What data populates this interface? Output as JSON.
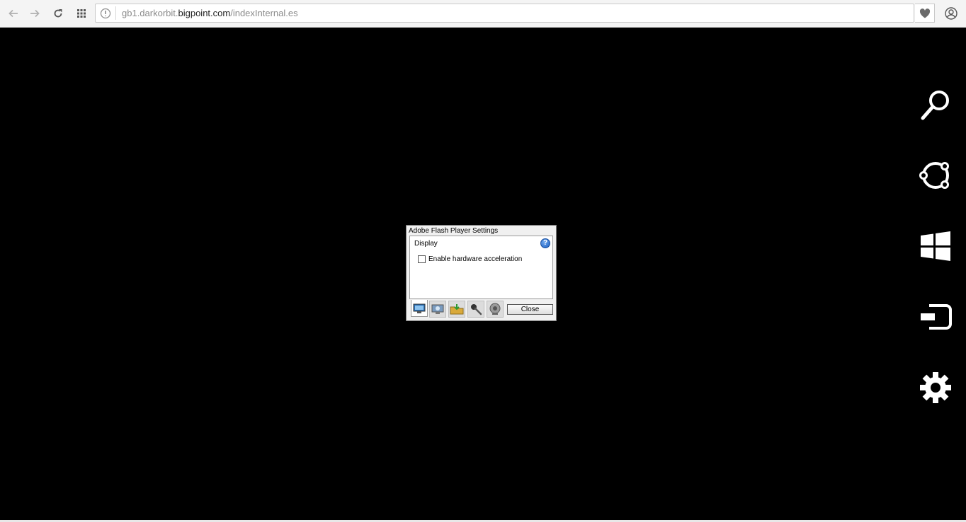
{
  "browser": {
    "url_prefix": "gb1.darkorbit.",
    "url_domain": "bigpoint.com",
    "url_path": "/indexInternal.es",
    "icons": {
      "back": "arrow-left-icon",
      "forward": "arrow-right-icon",
      "reload": "reload-icon",
      "apps": "apps-grid-icon",
      "site_info": "site-info-icon",
      "favorite": "heart-icon",
      "profile": "profile-icon"
    }
  },
  "charms": [
    {
      "name": "search",
      "icon": "search-icon"
    },
    {
      "name": "share",
      "icon": "share-icon"
    },
    {
      "name": "start",
      "icon": "windows-start-icon"
    },
    {
      "name": "devices",
      "icon": "devices-icon"
    },
    {
      "name": "settings",
      "icon": "gear-icon"
    }
  ],
  "flash_dialog": {
    "title": "Adobe Flash Player Settings",
    "section": "Display",
    "checkbox_label": "Enable hardware acceleration",
    "checkbox_checked": false,
    "close_label": "Close",
    "tabs": [
      {
        "name": "display",
        "icon": "monitor-icon",
        "active": true
      },
      {
        "name": "privacy",
        "icon": "privacy-monitor-icon",
        "active": false
      },
      {
        "name": "storage",
        "icon": "folder-download-icon",
        "active": false
      },
      {
        "name": "microphone",
        "icon": "microphone-icon",
        "active": false
      },
      {
        "name": "camera",
        "icon": "webcam-icon",
        "active": false
      }
    ]
  }
}
